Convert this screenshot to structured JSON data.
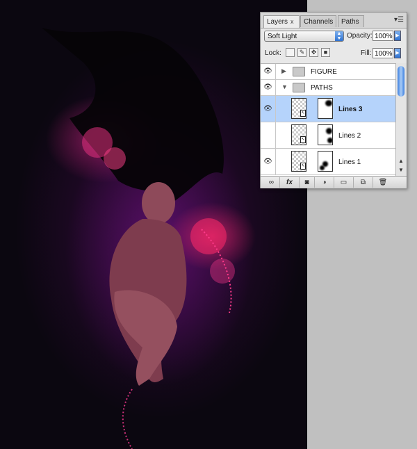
{
  "tabs": [
    {
      "label": "Layers",
      "close": "x",
      "active": true
    },
    {
      "label": "Channels",
      "active": false
    },
    {
      "label": "Paths",
      "active": false
    }
  ],
  "panel_menu_icon": "panel-menu-icon",
  "blend_mode": "Soft Light",
  "opacity": {
    "label": "Opacity:",
    "value": "100%"
  },
  "lock": {
    "label": "Lock:"
  },
  "fill": {
    "label": "Fill:",
    "value": "100%"
  },
  "layers": [
    {
      "name": "FIGURE",
      "type": "group",
      "expanded": false,
      "visible": true
    },
    {
      "name": "PATHS",
      "type": "group",
      "expanded": true,
      "visible": true
    },
    {
      "name": "Lines 3",
      "type": "layer",
      "selected": true,
      "visible": true
    },
    {
      "name": "Lines 2",
      "type": "layer",
      "selected": false,
      "visible": false
    },
    {
      "name": "Lines 1",
      "type": "layer",
      "selected": false,
      "visible": true
    }
  ],
  "bottom_buttons": [
    "link-icon",
    "fx-icon",
    "mask-icon",
    "adjustment-icon",
    "folder-icon",
    "new-layer-icon",
    "trash-icon"
  ],
  "colors": {
    "selection": "#b5d3fb",
    "accent": "#2f72d0",
    "canvas_bg": "#0b0710"
  }
}
